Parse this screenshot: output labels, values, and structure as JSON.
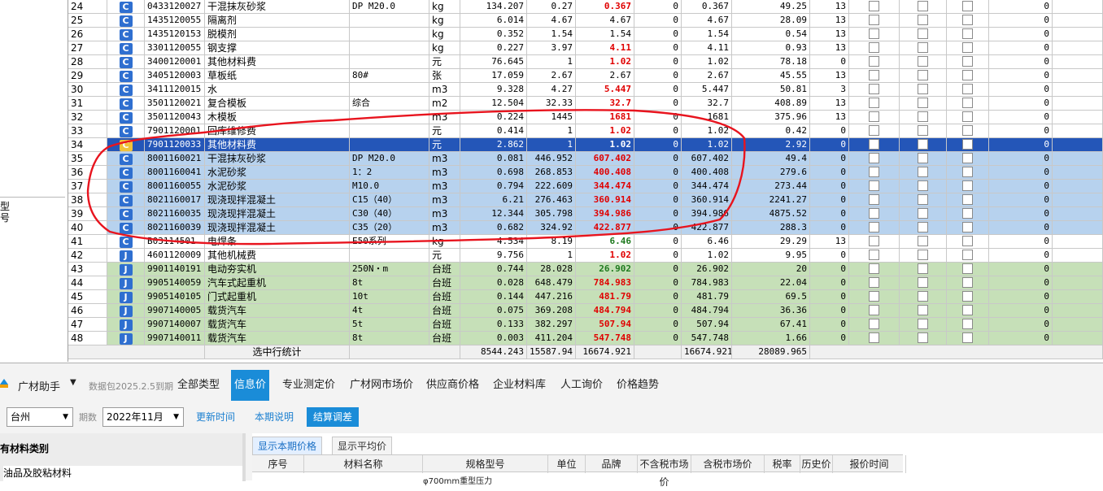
{
  "left_panel": {
    "frag_a": "型",
    "frag_b": "号"
  },
  "rows": [
    {
      "num": "24",
      "type": "C",
      "code": "0433120027",
      "name": "干混抹灰砂浆",
      "spec": "DP M20.0",
      "unit": "kg",
      "qty": "134.207",
      "p1": "0.27",
      "p2": "0.367",
      "p2c": "red",
      "p3": "0",
      "p4": "0.367",
      "total": "49.25",
      "tax": "13",
      "style": "white"
    },
    {
      "num": "25",
      "type": "C",
      "code": "1435120055",
      "name": "隔离剂",
      "spec": "",
      "unit": "kg",
      "qty": "6.014",
      "p1": "4.67",
      "p2": "4.67",
      "p2c": "",
      "p3": "0",
      "p4": "4.67",
      "total": "28.09",
      "tax": "13",
      "style": "white"
    },
    {
      "num": "26",
      "type": "C",
      "code": "1435120153",
      "name": "脱模剂",
      "spec": "",
      "unit": "kg",
      "qty": "0.352",
      "p1": "1.54",
      "p2": "1.54",
      "p2c": "",
      "p3": "0",
      "p4": "1.54",
      "total": "0.54",
      "tax": "13",
      "style": "white"
    },
    {
      "num": "27",
      "type": "C",
      "code": "3301120055",
      "name": "钢支撑",
      "spec": "",
      "unit": "kg",
      "qty": "0.227",
      "p1": "3.97",
      "p2": "4.11",
      "p2c": "red",
      "p3": "0",
      "p4": "4.11",
      "total": "0.93",
      "tax": "13",
      "style": "white"
    },
    {
      "num": "28",
      "type": "C",
      "code": "3400120001",
      "name": "其他材料费",
      "spec": "",
      "unit": "元",
      "qty": "76.645",
      "p1": "1",
      "p2": "1.02",
      "p2c": "red",
      "p3": "0",
      "p4": "1.02",
      "total": "78.18",
      "tax": "0",
      "style": "white"
    },
    {
      "num": "29",
      "type": "C",
      "code": "3405120003",
      "name": "草板纸",
      "spec": "80#",
      "unit": "张",
      "qty": "17.059",
      "p1": "2.67",
      "p2": "2.67",
      "p2c": "",
      "p3": "0",
      "p4": "2.67",
      "total": "45.55",
      "tax": "13",
      "style": "white"
    },
    {
      "num": "30",
      "type": "C",
      "code": "3411120015",
      "name": "水",
      "spec": "",
      "unit": "m3",
      "qty": "9.328",
      "p1": "4.27",
      "p2": "5.447",
      "p2c": "red",
      "p3": "0",
      "p4": "5.447",
      "total": "50.81",
      "tax": "3",
      "style": "white"
    },
    {
      "num": "31",
      "type": "C",
      "code": "3501120021",
      "name": "复合模板",
      "spec": "综合",
      "unit": "m2",
      "qty": "12.504",
      "p1": "32.33",
      "p2": "32.7",
      "p2c": "red",
      "p3": "0",
      "p4": "32.7",
      "total": "408.89",
      "tax": "13",
      "style": "white"
    },
    {
      "num": "32",
      "type": "C",
      "code": "3501120043",
      "name": "木模板",
      "spec": "",
      "unit": "m3",
      "qty": "0.224",
      "p1": "1445",
      "p2": "1681",
      "p2c": "red",
      "p3": "0",
      "p4": "1681",
      "total": "375.96",
      "tax": "13",
      "style": "white"
    },
    {
      "num": "33",
      "type": "C",
      "code": "7901120001",
      "name": "回库维修费",
      "spec": "",
      "unit": "元",
      "qty": "0.414",
      "p1": "1",
      "p2": "1.02",
      "p2c": "red",
      "p3": "0",
      "p4": "1.02",
      "total": "0.42",
      "tax": "0",
      "style": "white"
    },
    {
      "num": "34",
      "type": "C",
      "code": "7901120033",
      "name": "其他材料费",
      "spec": "",
      "unit": "元",
      "qty": "2.862",
      "p1": "1",
      "p2": "1.02",
      "p2c": "red",
      "p3": "0",
      "p4": "1.02",
      "total": "2.92",
      "tax": "0",
      "style": "active"
    },
    {
      "num": "35",
      "type": "C",
      "code": "8001160021",
      "name": "干混抹灰砂浆",
      "spec": "DP M20.0",
      "unit": "m3",
      "qty": "0.081",
      "p1": "446.952",
      "p2": "607.402",
      "p2c": "red",
      "p3": "0",
      "p4": "607.402",
      "total": "49.4",
      "tax": "0",
      "style": "sel"
    },
    {
      "num": "36",
      "type": "C",
      "code": "8001160041",
      "name": "水泥砂浆",
      "spec": "1：2",
      "unit": "m3",
      "qty": "0.698",
      "p1": "268.853",
      "p2": "400.408",
      "p2c": "red",
      "p3": "0",
      "p4": "400.408",
      "total": "279.6",
      "tax": "0",
      "style": "sel"
    },
    {
      "num": "37",
      "type": "C",
      "code": "8001160055",
      "name": "水泥砂浆",
      "spec": "M10.0",
      "unit": "m3",
      "qty": "0.794",
      "p1": "222.609",
      "p2": "344.474",
      "p2c": "red",
      "p3": "0",
      "p4": "344.474",
      "total": "273.44",
      "tax": "0",
      "style": "sel"
    },
    {
      "num": "38",
      "type": "C",
      "code": "8021160017",
      "name": "现浇现拌混凝土",
      "spec": "C15（40）",
      "unit": "m3",
      "qty": "6.21",
      "p1": "276.463",
      "p2": "360.914",
      "p2c": "red",
      "p3": "0",
      "p4": "360.914",
      "total": "2241.27",
      "tax": "0",
      "style": "sel"
    },
    {
      "num": "39",
      "type": "C",
      "code": "8021160035",
      "name": "现浇现拌混凝土",
      "spec": "C30（40）",
      "unit": "m3",
      "qty": "12.344",
      "p1": "305.798",
      "p2": "394.986",
      "p2c": "red",
      "p3": "0",
      "p4": "394.986",
      "total": "4875.52",
      "tax": "0",
      "style": "sel"
    },
    {
      "num": "40",
      "type": "C",
      "code": "8021160039",
      "name": "现浇现拌混凝土",
      "spec": "C35（20）",
      "unit": "m3",
      "qty": "0.682",
      "p1": "324.92",
      "p2": "422.877",
      "p2c": "red",
      "p3": "0",
      "p4": "422.877",
      "total": "288.3",
      "tax": "0",
      "style": "sel"
    },
    {
      "num": "41",
      "type": "C",
      "code": "B03114501",
      "name": "电焊条",
      "spec": "E50系列",
      "unit": "kg",
      "qty": "4.534",
      "p1": "8.19",
      "p2": "6.46",
      "p2c": "grn",
      "p3": "0",
      "p4": "6.46",
      "total": "29.29",
      "tax": "13",
      "style": "white"
    },
    {
      "num": "42",
      "type": "J",
      "code": "4601120009",
      "name": "其他机械费",
      "spec": "",
      "unit": "元",
      "qty": "9.756",
      "p1": "1",
      "p2": "1.02",
      "p2c": "red",
      "p3": "0",
      "p4": "1.02",
      "total": "9.95",
      "tax": "0",
      "style": "white"
    },
    {
      "num": "43",
      "type": "J",
      "code": "9901140191",
      "name": "电动夯实机",
      "spec": "250N・m",
      "unit": "台班",
      "qty": "0.744",
      "p1": "28.028",
      "p2": "26.902",
      "p2c": "grn",
      "p3": "0",
      "p4": "26.902",
      "total": "20",
      "tax": "0",
      "style": "green"
    },
    {
      "num": "44",
      "type": "J",
      "code": "9905140059",
      "name": "汽车式起重机",
      "spec": "8t",
      "unit": "台班",
      "qty": "0.028",
      "p1": "648.479",
      "p2": "784.983",
      "p2c": "red",
      "p3": "0",
      "p4": "784.983",
      "total": "22.04",
      "tax": "0",
      "style": "green"
    },
    {
      "num": "45",
      "type": "J",
      "code": "9905140105",
      "name": "门式起重机",
      "spec": "10t",
      "unit": "台班",
      "qty": "0.144",
      "p1": "447.216",
      "p2": "481.79",
      "p2c": "red",
      "p3": "0",
      "p4": "481.79",
      "total": "69.5",
      "tax": "0",
      "style": "green"
    },
    {
      "num": "46",
      "type": "J",
      "code": "9907140005",
      "name": "载货汽车",
      "spec": "4t",
      "unit": "台班",
      "qty": "0.075",
      "p1": "369.208",
      "p2": "484.794",
      "p2c": "red",
      "p3": "0",
      "p4": "484.794",
      "total": "36.36",
      "tax": "0",
      "style": "green"
    },
    {
      "num": "47",
      "type": "J",
      "code": "9907140007",
      "name": "载货汽车",
      "spec": "5t",
      "unit": "台班",
      "qty": "0.133",
      "p1": "382.297",
      "p2": "507.94",
      "p2c": "red",
      "p3": "0",
      "p4": "507.94",
      "total": "67.41",
      "tax": "0",
      "style": "green"
    },
    {
      "num": "48",
      "type": "J",
      "code": "9907140011",
      "name": "载货汽车",
      "spec": "8t",
      "unit": "台班",
      "qty": "0.003",
      "p1": "411.204",
      "p2": "547.748",
      "p2c": "red",
      "p3": "0",
      "p4": "547.748",
      "total": "1.66",
      "tax": "0",
      "style": "green"
    }
  ],
  "summary": {
    "label": "选中行统计",
    "qty": "8544.243",
    "p1": "15587.94",
    "p2": "16674.921",
    "p4": "16674.921",
    "total": "28089.965"
  },
  "assistant": {
    "brand": "广材助手",
    "expiry": "数据包2025.2.5到期",
    "tabs": [
      "全部类型",
      "信息价",
      "专业测定价",
      "广材网市场价",
      "供应商价格",
      "企业材料库",
      "人工询价",
      "价格趋势"
    ],
    "active_tab": "信息价",
    "region": "台州",
    "period_label": "期数",
    "period": "2022年11月",
    "btn_update": "更新时间",
    "btn_notes": "本期说明",
    "btn_adjust": "结算调差",
    "category_header": "有材料类别",
    "category_item": "油品及胶粘材料",
    "price_tabs": [
      "显示本期价格",
      "显示平均价"
    ],
    "columns": [
      "序号",
      "材料名称",
      "规格型号",
      "单位",
      "品牌",
      "不含税市场价",
      "含税市场价",
      "税率",
      "历史价",
      "报价时间"
    ],
    "row_fragment": "φ700mm重型压力"
  },
  "colors": {
    "accent": "#1a8cd8",
    "selected_row": "#b7d2ee",
    "active_row": "#2456b8",
    "machine_row": "#c6e0b8",
    "annotation": "#e8141e"
  }
}
